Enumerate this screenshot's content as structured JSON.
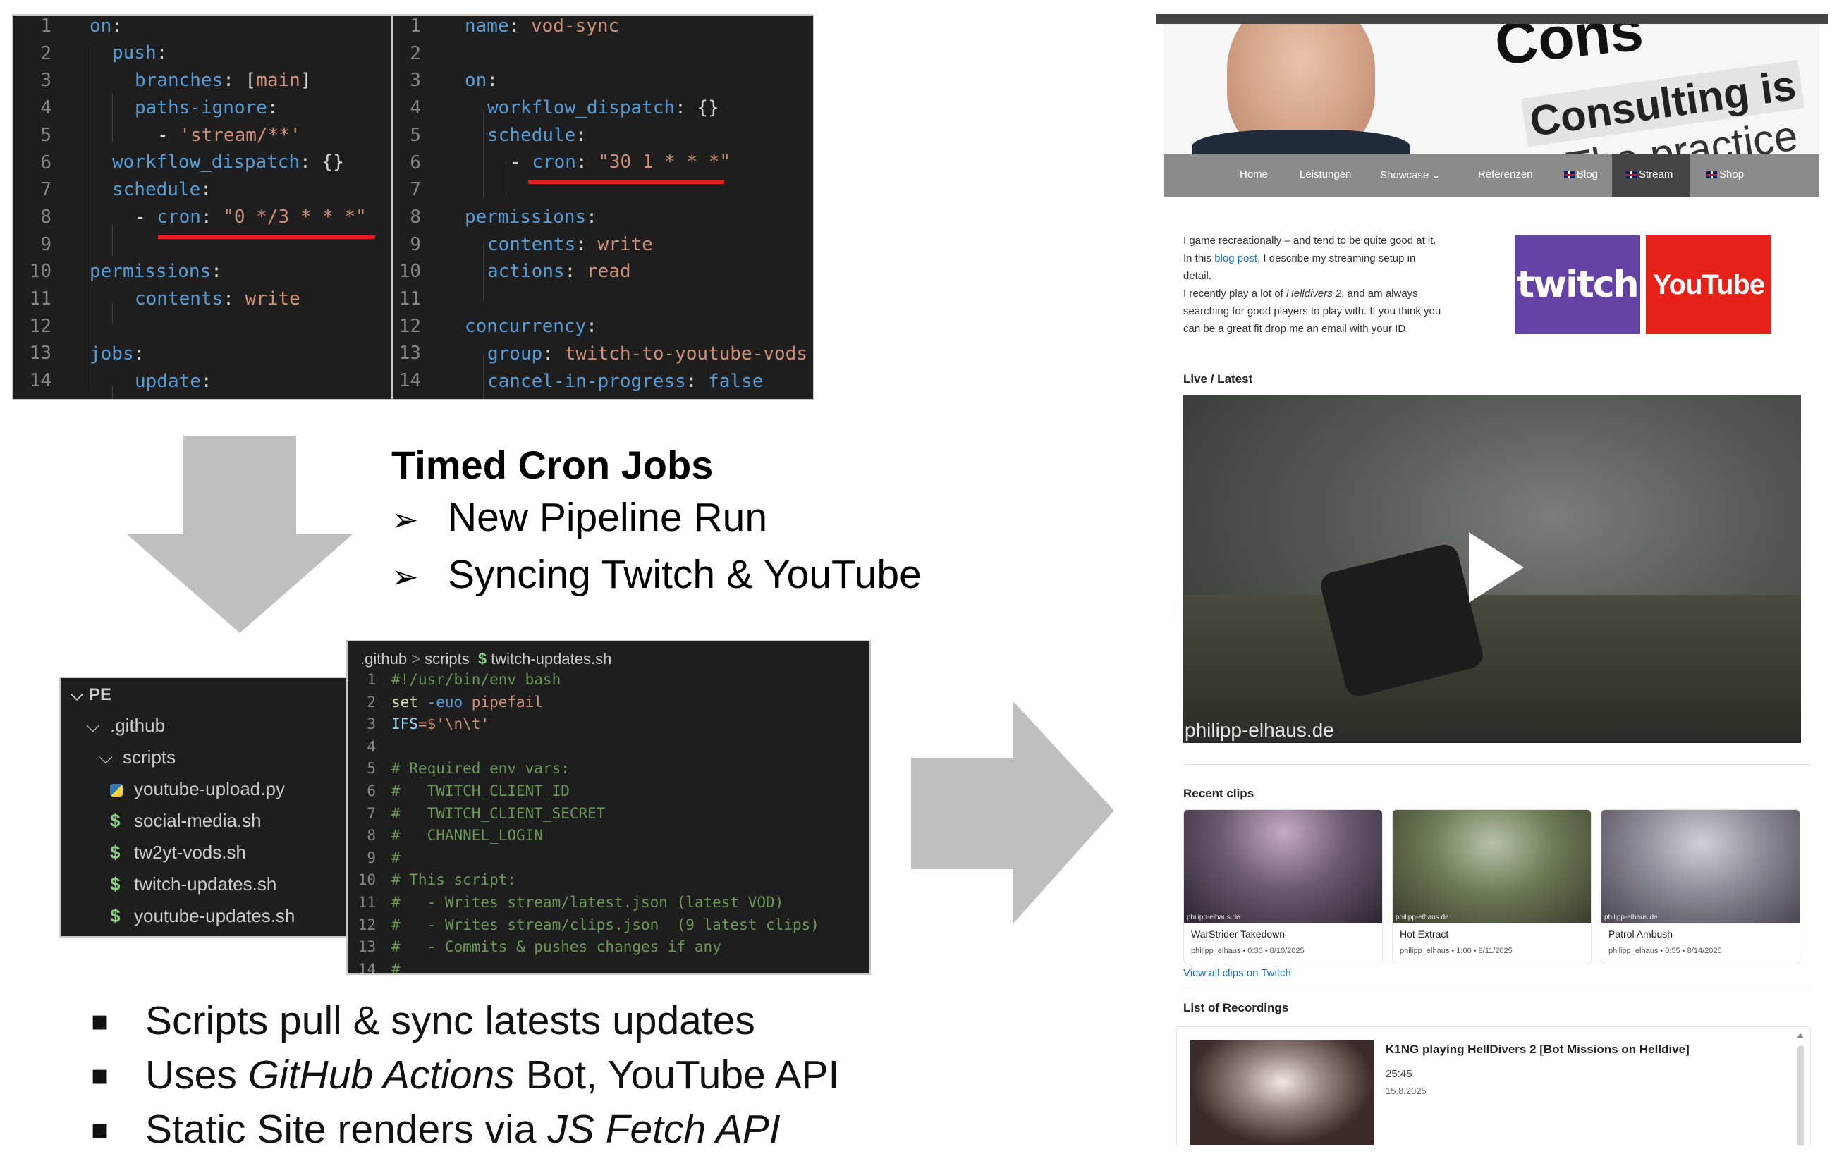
{
  "code1": {
    "lines": [
      {
        "n": "1"
      },
      {
        "n": "2"
      },
      {
        "n": "3"
      },
      {
        "n": "4"
      },
      {
        "n": "5"
      },
      {
        "n": "6"
      },
      {
        "n": "7"
      },
      {
        "n": "8"
      },
      {
        "n": "9"
      },
      {
        "n": "10"
      },
      {
        "n": "11"
      },
      {
        "n": "12"
      },
      {
        "n": "13"
      },
      {
        "n": "14"
      }
    ],
    "t": {
      "l1a": "on",
      "l1b": ":",
      "l2a": "push",
      "l2b": ":",
      "l3a": "branches",
      "l3b": ": [",
      "l3c": "main",
      "l3d": "]",
      "l4a": "paths-ignore",
      "l4b": ":",
      "l5a": "- ",
      "l5b": "'stream/**'",
      "l6a": "workflow_dispatch",
      "l6b": ": {}",
      "l7a": "schedule",
      "l7b": ":",
      "l8a": "- ",
      "l8b": "cron",
      "l8c": ": ",
      "l8d": "\"0 */3 * * *\"",
      "l10a": "permissions",
      "l10b": ":",
      "l11a": "contents",
      "l11b": ": ",
      "l11c": "write",
      "l13a": "jobs",
      "l13b": ":",
      "l14a": "update",
      "l14b": ":"
    }
  },
  "code2": {
    "lines": [
      {
        "n": "1"
      },
      {
        "n": "2"
      },
      {
        "n": "3"
      },
      {
        "n": "4"
      },
      {
        "n": "5"
      },
      {
        "n": "6"
      },
      {
        "n": "7"
      },
      {
        "n": "8"
      },
      {
        "n": "9"
      },
      {
        "n": "10"
      },
      {
        "n": "11"
      },
      {
        "n": "12"
      },
      {
        "n": "13"
      },
      {
        "n": "14"
      }
    ],
    "t": {
      "l1a": "name",
      "l1b": ": ",
      "l1c": "vod-sync",
      "l3a": "on",
      "l3b": ":",
      "l4a": "workflow_dispatch",
      "l4b": ": {}",
      "l5a": "schedule",
      "l5b": ":",
      "l6a": "- ",
      "l6b": "cron",
      "l6c": ": ",
      "l6d": "\"30 1 * * *\"",
      "l8a": "permissions",
      "l8b": ":",
      "l9a": "contents",
      "l9b": ": ",
      "l9c": "write",
      "l10a": "actions",
      "l10b": ": ",
      "l10c": "read",
      "l12a": "concurrency",
      "l12b": ":",
      "l13a": "group",
      "l13b": ": ",
      "l13c": "twitch-to-youtube-vods",
      "l14a": "cancel-in-progress",
      "l14b": ": ",
      "l14c": "false"
    }
  },
  "heading": {
    "title": "Timed Cron Jobs",
    "items": [
      "New Pipeline Run",
      "Syncing Twitch & YouTube"
    ],
    "marker": "➢"
  },
  "tree": {
    "root": "PE",
    "folder1": ".github",
    "folder2": "scripts",
    "files": [
      {
        "name": "youtube-upload.py",
        "kind": "python"
      },
      {
        "name": "social-media.sh",
        "kind": "shell"
      },
      {
        "name": "tw2yt-vods.sh",
        "kind": "shell"
      },
      {
        "name": "twitch-updates.sh",
        "kind": "shell"
      },
      {
        "name": "youtube-updates.sh",
        "kind": "shell"
      }
    ],
    "dollar": "$"
  },
  "code3": {
    "breadcrumb": {
      "a": ".github",
      "sep": ">",
      "b": "scripts",
      "c": "twitch-updates.sh"
    },
    "lines": [
      {
        "n": "1",
        "t": "#!/usr/bin/env bash"
      },
      {
        "n": "2",
        "t1": "set ",
        "t2": "-euo ",
        "t3": "pipefail"
      },
      {
        "n": "3",
        "t1": "IFS",
        "t2": "=$'\\n\\t'"
      },
      {
        "n": "4",
        "t": ""
      },
      {
        "n": "5",
        "t": "# Required env vars:"
      },
      {
        "n": "6",
        "t": "#   TWITCH_CLIENT_ID"
      },
      {
        "n": "7",
        "t": "#   TWITCH_CLIENT_SECRET"
      },
      {
        "n": "8",
        "t": "#   CHANNEL_LOGIN"
      },
      {
        "n": "9",
        "t": "#"
      },
      {
        "n": "10",
        "t": "# This script:"
      },
      {
        "n": "11",
        "t": "#   - Writes stream/latest.json (latest VOD)"
      },
      {
        "n": "12",
        "t": "#   - Writes stream/clips.json  (9 latest clips)"
      },
      {
        "n": "13",
        "t": "#   - Commits & pushes changes if any"
      },
      {
        "n": "14",
        "t": "#"
      }
    ]
  },
  "bullets": {
    "marker": "▪",
    "b1": "Scripts pull & sync latests updates",
    "b2a": "Uses ",
    "b2b": "GitHub Actions",
    "b2c": " Bot, YouTube API",
    "b3a": "Static Site renders via ",
    "b3b": "JS Fetch API"
  },
  "site": {
    "banner_word": "Cons",
    "banner_line1": "Consulting is",
    "banner_line2": "The practice",
    "nav": [
      "Home",
      "Leistungen",
      "Showcase",
      "Referenzen",
      "Blog",
      "Stream",
      "Shop"
    ],
    "nav_caret": "⌄",
    "intro": {
      "p1": "I game recreationally – and tend to be quite good at it.",
      "p2a": "In this ",
      "p2link": "blog post",
      "p2b": ", I describe my streaming setup in",
      "p2c": "detail.",
      "p3a": "I recently play a lot of ",
      "p3em": "Helldivers 2",
      "p3b": ", and am always",
      "p3c": "searching for good players to play with. If you think you",
      "p3d": "can be a great fit drop me an email with your ID."
    },
    "twitch_logo": "twitch",
    "youtube_logo": "YouTube",
    "live_heading": "Live / Latest",
    "watermark": "philipp-elhaus.de",
    "recent_heading": "Recent clips",
    "clips": [
      {
        "title": "WarStrider Takedown",
        "meta": "philipp_elhaus • 0:30 • 8/10/2025"
      },
      {
        "title": "Hot Extract",
        "meta": "philipp_elhaus • 1:00 • 8/11/2025"
      },
      {
        "title": "Patrol Ambush",
        "meta": "philipp_elhaus • 0:55 • 8/14/2025"
      }
    ],
    "clip_watermark": "philipp-elhaus.de",
    "view_all": "View all clips on Twitch",
    "recordings_heading": "List of Recordings",
    "recording": {
      "title": "K1NG playing HellDivers 2 [Bot Missions on Helldive]",
      "duration": "25:45",
      "date": "15.8.2025"
    }
  },
  "colors": {
    "arrow": "#bfbfbf",
    "accent_red": "#e3201b",
    "twitch": "#6441a5",
    "youtube": "#e62117",
    "nav": "#8a8a8a",
    "nav_active": "#444444",
    "link": "#1a6fc2"
  }
}
